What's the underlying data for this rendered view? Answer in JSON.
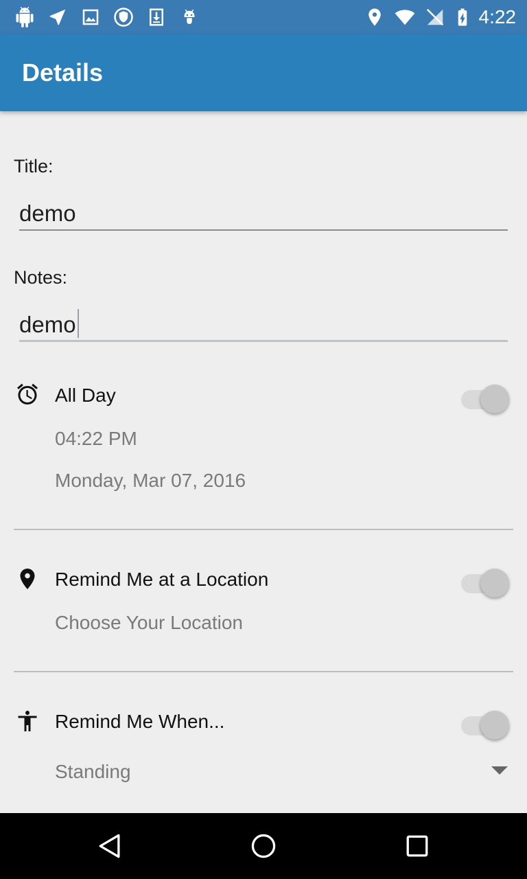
{
  "status_bar": {
    "time": "4:22",
    "left_icons": [
      "android-icon",
      "navigation-icon",
      "image-icon",
      "shield-icon",
      "download-icon",
      "android-bug-icon"
    ],
    "right_icons": [
      "location-icon",
      "wifi-icon",
      "no-signal-icon",
      "battery-charging-icon"
    ],
    "background": "#3a7bb4"
  },
  "app_bar": {
    "title": "Details",
    "background": "#2a80bb"
  },
  "form": {
    "title_label": "Title:",
    "title_value": "demo",
    "notes_label": "Notes:",
    "notes_value": "demo"
  },
  "all_day": {
    "label": "All Day",
    "time": "04:22 PM",
    "date": "Monday, Mar 07, 2016",
    "enabled": false,
    "icon": "alarm-icon"
  },
  "location": {
    "label": "Remind Me at a Location",
    "placeholder": "Choose Your Location",
    "enabled": false,
    "icon": "place-icon"
  },
  "activity": {
    "label": "Remind Me When...",
    "selected": "Standing",
    "enabled": false,
    "icon": "accessibility-icon"
  },
  "nav_bar": {
    "buttons": [
      "back-icon",
      "home-icon",
      "recents-icon"
    ]
  }
}
